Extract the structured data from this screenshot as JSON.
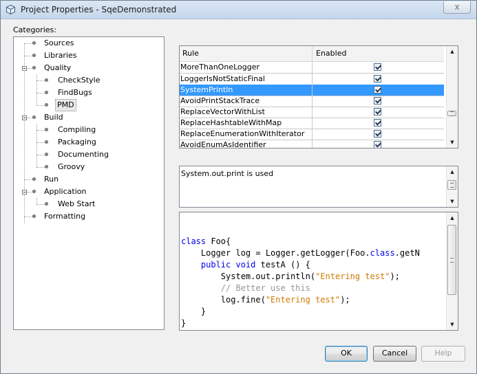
{
  "window": {
    "title": "Project Properties - SqeDemonstrated",
    "close_glyph": "x"
  },
  "categories_label": "Categories:",
  "tree": {
    "sources": "Sources",
    "libraries": "Libraries",
    "quality": "Quality",
    "checkstyle": "CheckStyle",
    "findbugs": "FindBugs",
    "pmd": "PMD",
    "build": "Build",
    "compiling": "Compiling",
    "packaging": "Packaging",
    "documenting": "Documenting",
    "groovy": "Groovy",
    "run": "Run",
    "application": "Application",
    "web_start": "Web Start",
    "formatting": "Formatting"
  },
  "rules_table": {
    "col_rule": "Rule",
    "col_enabled": "Enabled",
    "rows": [
      {
        "name": "MoreThanOneLogger",
        "enabled": true
      },
      {
        "name": "LoggerIsNotStaticFinal",
        "enabled": true
      },
      {
        "name": "SystemPrintln",
        "enabled": true
      },
      {
        "name": "AvoidPrintStackTrace",
        "enabled": true
      },
      {
        "name": "ReplaceVectorWithList",
        "enabled": true
      },
      {
        "name": "ReplaceHashtableWithMap",
        "enabled": true
      },
      {
        "name": "ReplaceEnumerationWithIterator",
        "enabled": true
      },
      {
        "name": "AvoidEnumAsIdentifier",
        "enabled": true
      }
    ],
    "selected_rule": "SystemPrintln"
  },
  "description": "System.out.print is used",
  "code_example": {
    "l1_kw": "class",
    "l1_rest": " Foo{",
    "l2": "    Logger log = Logger.getLogger(Foo.",
    "l2_kw": "class",
    "l2_rest": ".getN",
    "l3_pre": "    ",
    "l3_kw1": "public",
    "l3_sp": " ",
    "l3_kw2": "void",
    "l3_rest": " testA () {",
    "l4_pre": "        System.out.println(",
    "l4_str": "\"Entering test\"",
    "l4_post": ");",
    "l5_pre": "        ",
    "l5_cm": "// Better use this",
    "l6_pre": "        log.fine(",
    "l6_str": "\"Entering test\"",
    "l6_post": ");",
    "l7": "    }",
    "l8": "}"
  },
  "buttons": {
    "ok": "OK",
    "cancel": "Cancel",
    "help": "Help"
  },
  "colors": {
    "selection": "#3399ff",
    "keyword": "#0000e6",
    "string": "#ce7b00",
    "comment": "#969696"
  }
}
